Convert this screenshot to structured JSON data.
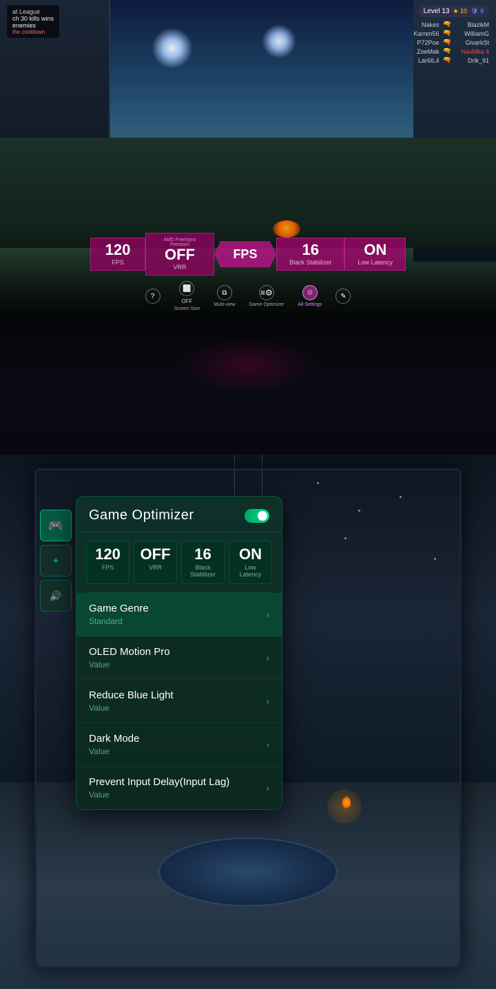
{
  "topSection": {
    "hudLeft": {
      "gameName": "at League",
      "killInfo": "ch 30 kills wins",
      "enemyInfo": "enemies",
      "cooldown": "the cooldown"
    },
    "hudRight": {
      "levelText": "Level 13",
      "starCount": "10",
      "shieldIcon": "9",
      "players": [
        {
          "name": "Nakes",
          "kills": ""
        },
        {
          "name": "Karren56",
          "kills": ""
        },
        {
          "name": "P72Poe",
          "kills": ""
        },
        {
          "name": "ZoeMak",
          "kills": "4"
        },
        {
          "name": "Lar6IL4",
          "kills": ""
        }
      ]
    },
    "stats": [
      {
        "value": "120",
        "label": "FPS",
        "sublabel": ""
      },
      {
        "value": "OFF",
        "label": "VRR",
        "sublabel": "AMD FreeSync Premium"
      },
      {
        "value": "FPS",
        "label": "",
        "sublabel": ""
      },
      {
        "value": "16",
        "label": "Black Stabilizer",
        "sublabel": ""
      },
      {
        "value": "ON",
        "label": "Low Latency",
        "sublabel": ""
      }
    ],
    "controls": [
      {
        "icon": "?",
        "label": "",
        "active": false
      },
      {
        "icon": "⬛",
        "label": "Screen Size",
        "active": false
      },
      {
        "icon": "⧉",
        "label": "Multi-view",
        "active": false
      },
      {
        "icon": "⚙",
        "label": "Game Optimizer",
        "active": false
      },
      {
        "icon": "⚙",
        "label": "All Settings",
        "active": true
      },
      {
        "icon": "✎",
        "label": "",
        "active": false
      }
    ]
  },
  "bottomSection": {
    "panel": {
      "title": "Game Optimizer",
      "toggleState": "on",
      "stats": [
        {
          "value": "120",
          "label": "FPS"
        },
        {
          "value": "OFF",
          "label": "VRR"
        },
        {
          "value": "16",
          "label": "Black Stabilizer"
        },
        {
          "value": "ON",
          "label": "Low Latency"
        }
      ],
      "menuItems": [
        {
          "title": "Game Genre",
          "value": "Standard",
          "highlighted": true
        },
        {
          "title": "OLED Motion Pro",
          "value": "Value",
          "highlighted": false
        },
        {
          "title": "Reduce Blue Light",
          "value": "Value",
          "highlighted": false
        },
        {
          "title": "Dark Mode",
          "value": "Value",
          "highlighted": false
        },
        {
          "title": "Prevent Input Delay(Input Lag)",
          "value": "Value",
          "highlighted": false
        }
      ]
    },
    "sideIcons": [
      {
        "icon": "🎮",
        "label": "gamepad-icon",
        "active": true
      },
      {
        "icon": "✦",
        "label": "display-icon",
        "active": false
      },
      {
        "icon": "🔊",
        "label": "sound-icon",
        "active": false
      }
    ]
  }
}
